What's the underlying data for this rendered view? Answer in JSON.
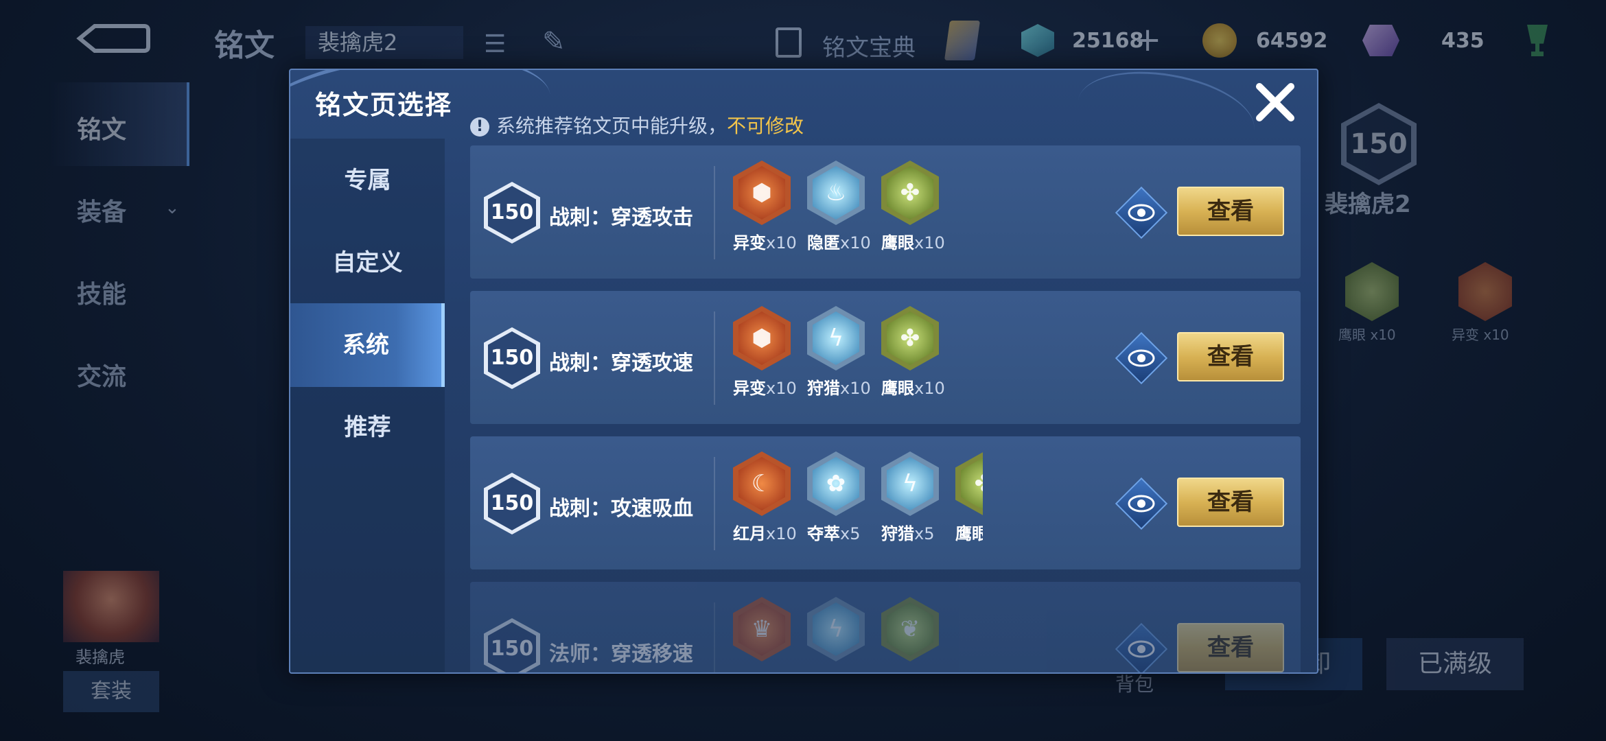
{
  "topbar": {
    "title": "铭文",
    "page_name": "裴擒虎2",
    "codex_label": "铭文宝典",
    "currencies": {
      "gems": "25168",
      "gold": "64592",
      "crystals": "435"
    }
  },
  "leftnav": {
    "items": [
      "铭文",
      "装备",
      "技能",
      "交流"
    ],
    "active": "铭文"
  },
  "hero": {
    "name": "裴擒虎",
    "suit_label": "套装"
  },
  "right_panel": {
    "level": "150",
    "page_name": "裴擒虎2",
    "runes": [
      {
        "label": "鹰眼 x10"
      },
      {
        "label": "异变 x10"
      }
    ],
    "bag_label": "背包",
    "unload_label": "一键卸",
    "maxed_label": "已满级"
  },
  "modal": {
    "title": "铭文页选择",
    "notice_text": "系统推荐铭文页中能升级，",
    "notice_highlight": "不可修改",
    "tabs": [
      "专属",
      "自定义",
      "系统",
      "推荐"
    ],
    "active_tab": "系统",
    "pages": [
      {
        "level": "150",
        "name": "战刺：穿透攻击",
        "runes": [
          {
            "name": "异变",
            "count": "x10",
            "color": "red",
            "icon": "hexagon-rune-icon"
          },
          {
            "name": "隐匿",
            "count": "x10",
            "color": "blue",
            "icon": "flame-rune-icon"
          },
          {
            "name": "鹰眼",
            "count": "x10",
            "color": "green",
            "icon": "clover-rune-icon"
          }
        ],
        "view_label": "查看"
      },
      {
        "level": "150",
        "name": "战刺：穿透攻速",
        "runes": [
          {
            "name": "异变",
            "count": "x10",
            "color": "red",
            "icon": "hexagon-rune-icon"
          },
          {
            "name": "狩猎",
            "count": "x10",
            "color": "blue",
            "icon": "lightning-rune-icon"
          },
          {
            "name": "鹰眼",
            "count": "x10",
            "color": "green",
            "icon": "clover-rune-icon"
          }
        ],
        "view_label": "查看"
      },
      {
        "level": "150",
        "name": "战刺：攻速吸血",
        "runes": [
          {
            "name": "红月",
            "count": "x10",
            "color": "red",
            "icon": "moon-rune-icon"
          },
          {
            "name": "夺萃",
            "count": "x5",
            "color": "blue",
            "icon": "knot-rune-icon"
          },
          {
            "name": "狩猎",
            "count": "x5",
            "color": "blue",
            "icon": "lightning-rune-icon"
          },
          {
            "name": "鹰眼",
            "count": "",
            "color": "green",
            "icon": "clover-rune-icon"
          }
        ],
        "view_label": "查看"
      },
      {
        "level": "150",
        "name": "法师：穿透移速",
        "runes": [
          {
            "name": "",
            "count": "",
            "color": "red",
            "icon": "crown-rune-icon"
          },
          {
            "name": "",
            "count": "",
            "color": "blue",
            "icon": "lightning-rune-icon"
          },
          {
            "name": "",
            "count": "",
            "color": "green",
            "icon": "leaf-rune-icon"
          }
        ],
        "view_label": "查看"
      }
    ]
  },
  "colors": {
    "accent_gold": "#d8b254",
    "highlight_yellow": "#f3c54a",
    "modal_bg": "#2a4878"
  }
}
